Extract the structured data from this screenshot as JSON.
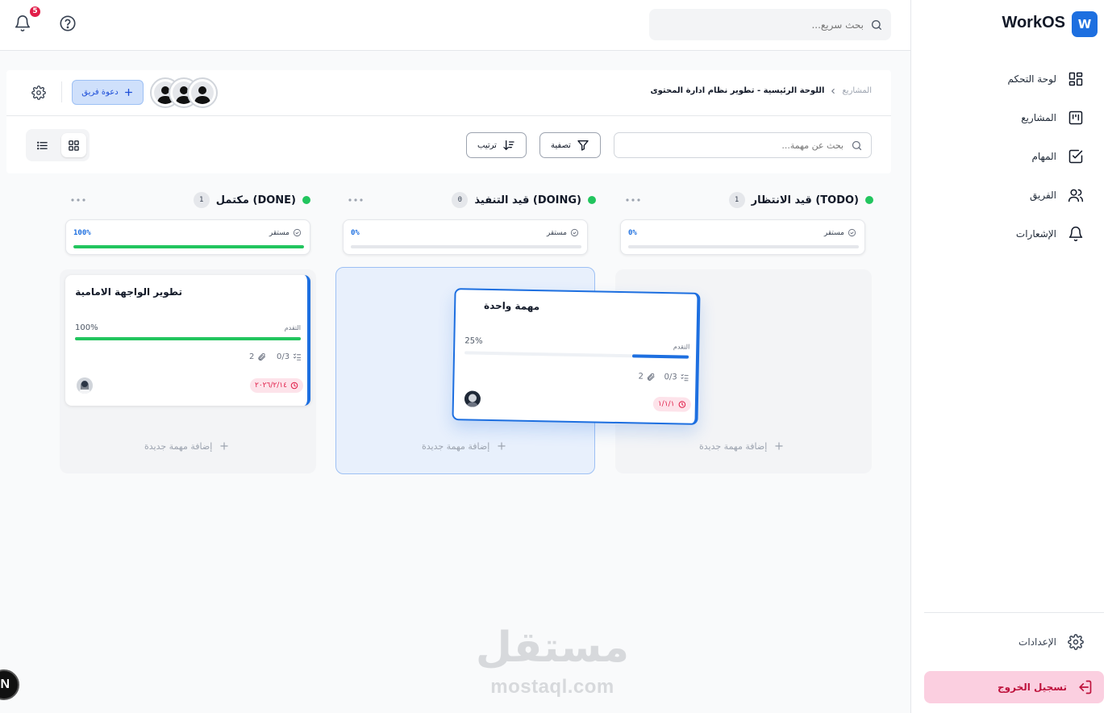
{
  "brand": {
    "logo_letter": "W",
    "name": "WorkOS",
    "accent": "#1d6fe0"
  },
  "topbar": {
    "search_placeholder": "بحث سريع...",
    "notifications_count": "5"
  },
  "sidebar": {
    "items": [
      {
        "label": "لوحة التحكم",
        "icon": "dashboard-icon"
      },
      {
        "label": "المشاريع",
        "icon": "kanban-icon"
      },
      {
        "label": "المهام",
        "icon": "check-square-icon"
      },
      {
        "label": "الفريق",
        "icon": "users-icon"
      },
      {
        "label": "الإشعارات",
        "icon": "bell-icon"
      }
    ],
    "settings_label": "الإعدادات",
    "logout_label": "تسجيل الخروج"
  },
  "header": {
    "breadcrumb_root": "المشاريع",
    "breadcrumb_current": "اللوحة الرئيسية - تطوير نظام ادارة المحتوى",
    "invite_label": "دعوة فريق",
    "search_placeholder": "بحث عن مهمة...",
    "filter_label": "تصفية",
    "sort_label": "ترتيب",
    "view_mode": "grid"
  },
  "columns": [
    {
      "title": "قيد الانتظار (TODO)",
      "count": "1",
      "status": "مستقر",
      "progress_label": "0%",
      "progress": 0,
      "add_label": "إضافة مهمة جديدة"
    },
    {
      "title": "قيد التنفيذ (DOING)",
      "count": "0",
      "status": "مستقر",
      "progress_label": "0%",
      "progress": 0,
      "add_label": "إضافة مهمة جديدة"
    },
    {
      "title": "مكتمل (DONE)",
      "count": "1",
      "status": "مستقر",
      "progress_label": "100%",
      "progress": 100,
      "add_label": "إضافة مهمة جديدة"
    }
  ],
  "tasks": [
    {
      "title": "تطوير الواجهة الامامية",
      "progress_label": "التقدم",
      "progress_text": "100%",
      "progress": 100,
      "subtasks": "0/3",
      "attachments": "2",
      "due": "٢٠٢٦/٢/١٤"
    },
    {
      "title": "مهمة واحدة",
      "progress_label": "التقدم",
      "progress_text": "25%",
      "progress": 25,
      "subtasks": "0/3",
      "attachments": "2",
      "due": "١/١/١"
    }
  ],
  "watermark": {
    "ar": "مستقل",
    "en": "mostaql.com"
  },
  "corner_badge": "N"
}
